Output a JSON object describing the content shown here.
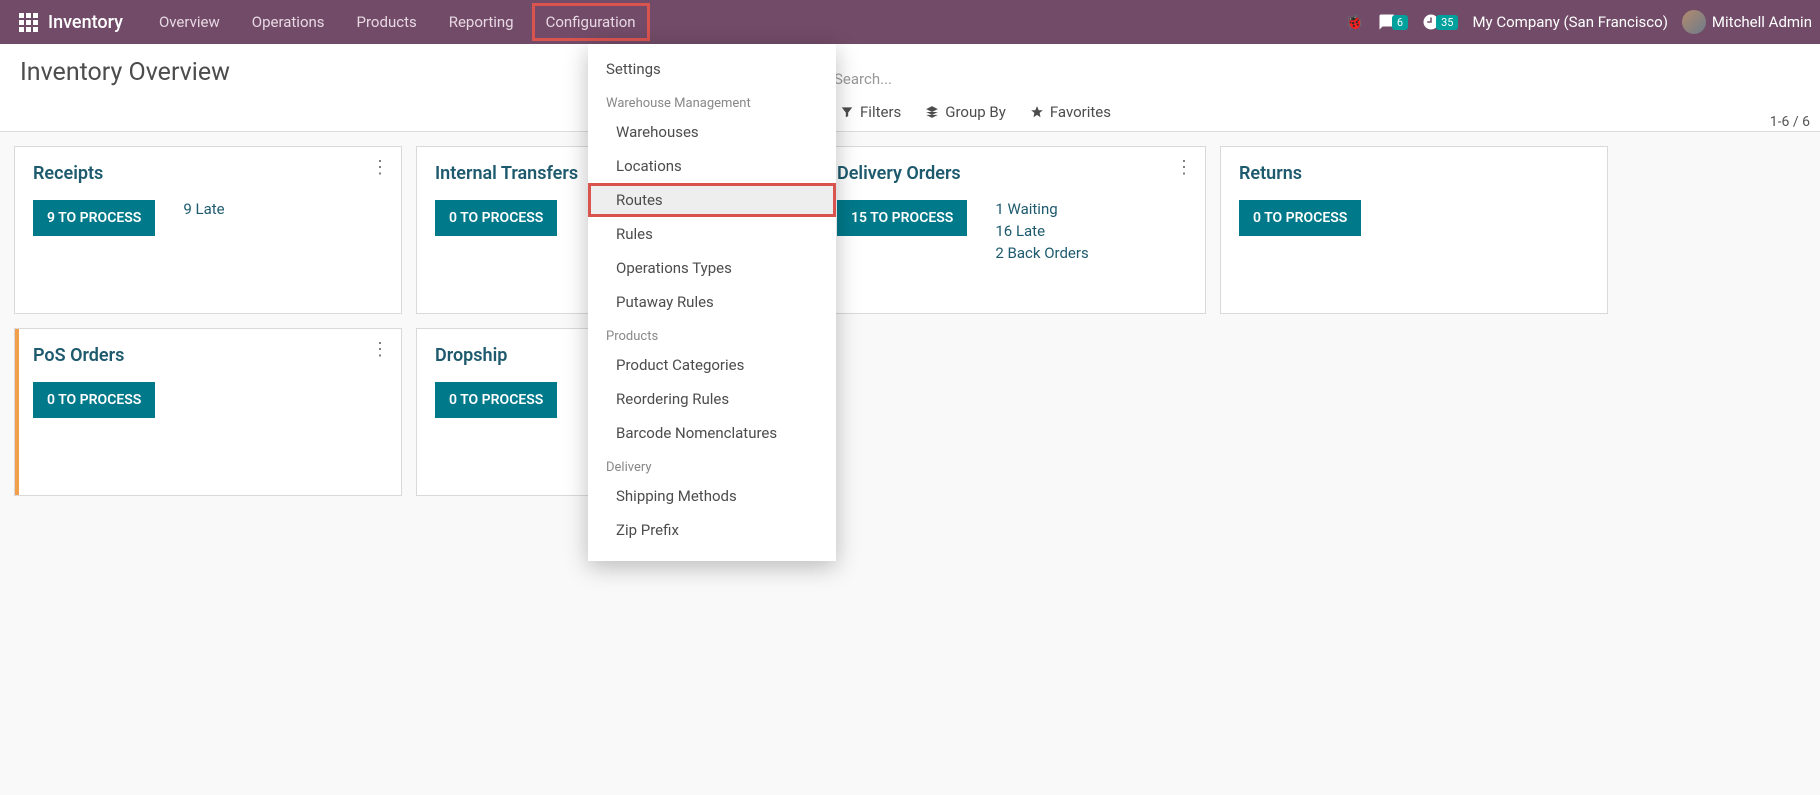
{
  "app": {
    "title": "Inventory"
  },
  "nav": {
    "items": [
      "Overview",
      "Operations",
      "Products",
      "Reporting",
      "Configuration"
    ]
  },
  "topRight": {
    "messages_badge": "6",
    "activities_badge": "35",
    "company": "My Company (San Francisco)",
    "user": "Mitchell Admin"
  },
  "page": {
    "title": "Inventory Overview",
    "search_placeholder": "Search...",
    "filters_label": "Filters",
    "groupby_label": "Group By",
    "favorites_label": "Favorites",
    "pager": "1-6 / 6"
  },
  "cards": [
    {
      "title": "Receipts",
      "button": "9 TO PROCESS",
      "statuses": [
        "9 Late"
      ],
      "accent": false,
      "kebab": true
    },
    {
      "title": "Internal Transfers",
      "button": "0 TO PROCESS",
      "statuses": [],
      "accent": false,
      "kebab": false
    },
    {
      "title": "Delivery Orders",
      "button": "15 TO PROCESS",
      "statuses": [
        "1 Waiting",
        "16 Late",
        "2 Back Orders"
      ],
      "accent": false,
      "kebab": true
    },
    {
      "title": "Returns",
      "button": "0 TO PROCESS",
      "statuses": [],
      "accent": false,
      "kebab": false
    },
    {
      "title": "PoS Orders",
      "button": "0 TO PROCESS",
      "statuses": [],
      "accent": true,
      "kebab": true
    },
    {
      "title": "Dropship",
      "button": "0 TO PROCESS",
      "statuses": [],
      "accent": false,
      "kebab": false
    }
  ],
  "dropdown": {
    "top": "Settings",
    "sections": [
      {
        "header": "Warehouse Management",
        "items": [
          "Warehouses",
          "Locations",
          "Routes",
          "Rules",
          "Operations Types",
          "Putaway Rules"
        ]
      },
      {
        "header": "Products",
        "items": [
          "Product Categories",
          "Reordering Rules",
          "Barcode Nomenclatures"
        ]
      },
      {
        "header": "Delivery",
        "items": [
          "Shipping Methods",
          "Zip Prefix"
        ]
      }
    ]
  }
}
